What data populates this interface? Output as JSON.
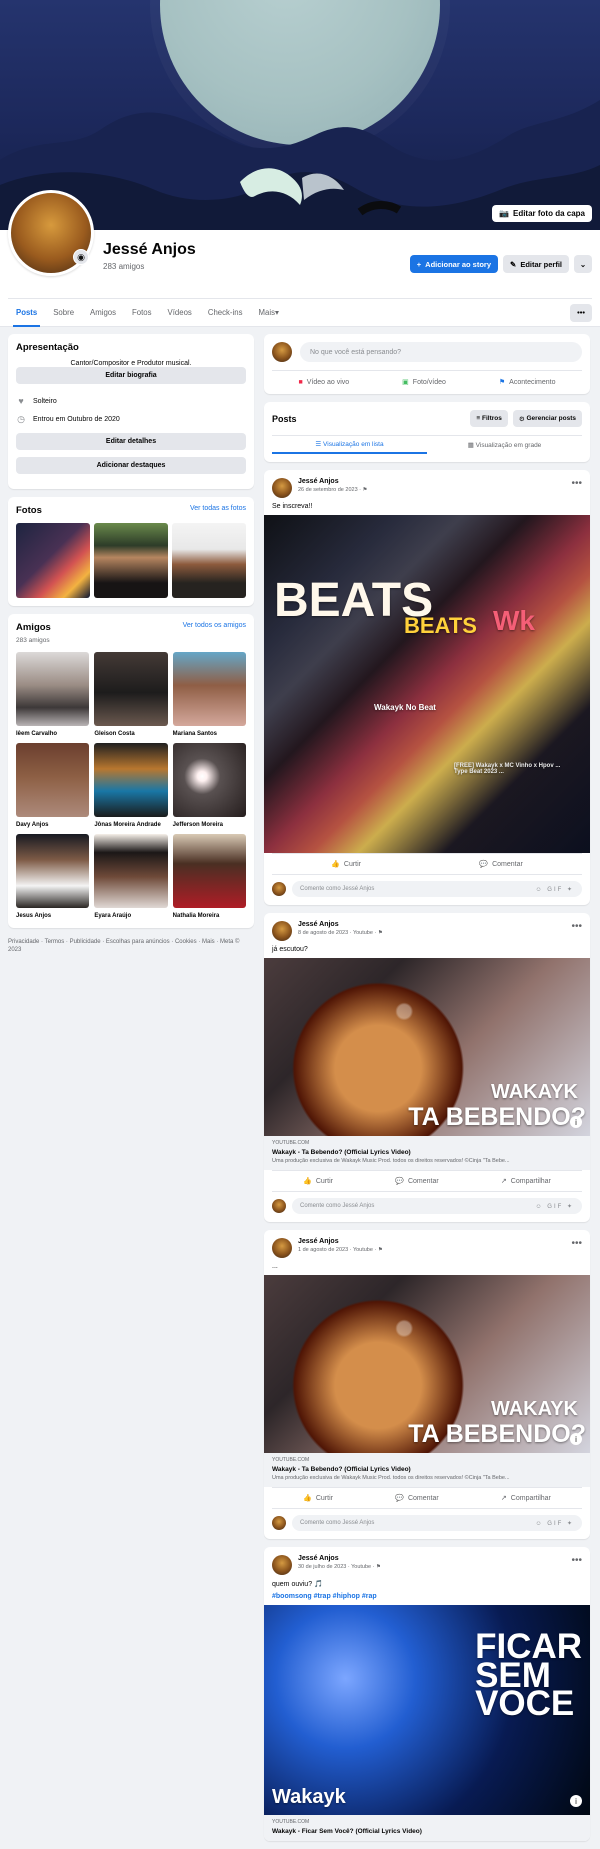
{
  "cover": {
    "edit_cover_label": "Editar foto da capa"
  },
  "profile": {
    "name": "Jessé Anjos",
    "friends_count": "283 amigos",
    "add_story_label": "Adicionar ao story",
    "edit_profile_label": "Editar perfil"
  },
  "tabs": [
    "Posts",
    "Sobre",
    "Amigos",
    "Fotos",
    "Vídeos",
    "Check-ins",
    "Mais"
  ],
  "intro": {
    "title": "Apresentação",
    "bio": "Cantor/Compositor e Produtor musical.",
    "edit_bio": "Editar biografia",
    "relationship": "Solteiro",
    "joined": "Entrou em Outubro de 2020",
    "edit_details": "Editar detalhes",
    "add_highlights": "Adicionar destaques"
  },
  "photos": {
    "title": "Fotos",
    "see_all": "Ver todas as fotos"
  },
  "friends": {
    "title": "Amigos",
    "count": "283 amigos",
    "see_all": "Ver todos os amigos",
    "items": [
      {
        "name": "Iêem Carvalho"
      },
      {
        "name": "Gleison Costa"
      },
      {
        "name": "Mariana Santos"
      },
      {
        "name": "Davy Anjos"
      },
      {
        "name": "Jônas Moreira Andrade"
      },
      {
        "name": "Jefferson Moreira"
      },
      {
        "name": "Jesus Anjos"
      },
      {
        "name": "Eyara Araújo"
      },
      {
        "name": "Nathalia Moreira"
      }
    ]
  },
  "footer": {
    "text": "Privacidade · Termos · Publicidade · Escolhas para anúncios · Cookies · Mais · Meta © 2023"
  },
  "composer": {
    "placeholder": "No que você está pensando?",
    "live_video": "Vídeo ao vivo",
    "photo_video": "Foto/vídeo",
    "life_event": "Acontecimento"
  },
  "posts_header": {
    "title": "Posts",
    "filters": "Filtros",
    "manage": "Gerenciar posts",
    "list_view": "Visualização em lista",
    "grid_view": "Visualização em grade"
  },
  "posts": [
    {
      "author": "Jessé Anjos",
      "date": "26 de setembro de 2023 · ⚑",
      "text": "Se inscreva!!",
      "youtube": {
        "big_text_1": "BEATS",
        "big_text_2": "BEATS",
        "channel_name": "Wakayk No Beat",
        "video_caption": "[FREE] Wakayk x MC Vinho x Hpov ... Type Beat 2023 ..."
      },
      "like": "Curtir",
      "comment": "Comentar",
      "comment_placeholder": "Comente como Jessé Anjos"
    },
    {
      "author": "Jessé Anjos",
      "date": "8 de agosto de 2023 · Youtube · ⚑",
      "text": "já escutou?",
      "hero_text_1": "WAKAYK",
      "hero_text_2": "TA BEBENDO?",
      "domain": "YOUTUBE.COM",
      "link_title": "Wakayk - Ta Bebendo? (Official Lyrics Video)",
      "link_desc": "Uma produção exclusiva de Wakayk Music Prod. todos os direitos reservados! ©Cinja \"Ta Bebe...",
      "like": "Curtir",
      "comment": "Comentar",
      "share": "Compartilhar",
      "comment_placeholder": "Comente como Jessé Anjos"
    },
    {
      "author": "Jessé Anjos",
      "date": "1 de agosto de 2023 · Youtube · ⚑",
      "text": "...",
      "hero_text_1": "WAKAYK",
      "hero_text_2": "TA BEBENDO?",
      "domain": "YOUTUBE.COM",
      "link_title": "Wakayk - Ta Bebendo? (Official Lyrics Video)",
      "link_desc": "Uma produção exclusiva de Wakayk Music Prod. todos os direitos reservados! ©Cinja \"Ta Bebe...",
      "like": "Curtir",
      "comment": "Comentar",
      "share": "Compartilhar",
      "comment_placeholder": "Comente como Jessé Anjos"
    },
    {
      "author": "Jessé Anjos",
      "date": "30 de julho de 2023 · Youtube · ⚑",
      "text": "quem ouviu? 🎵",
      "hashtags": "#boomsong #trap #hiphop #rap",
      "hero_text_1": "FICAR\nSEM\nVOCE",
      "hero_text_2": "Wakayk",
      "domain": "YOUTUBE.COM",
      "link_title": "Wakayk - Ficar Sem Você? (Official Lyrics Video)"
    }
  ],
  "colors": {
    "facebook_blue": "#1b74e4",
    "page_background": "#f0f2f5"
  }
}
